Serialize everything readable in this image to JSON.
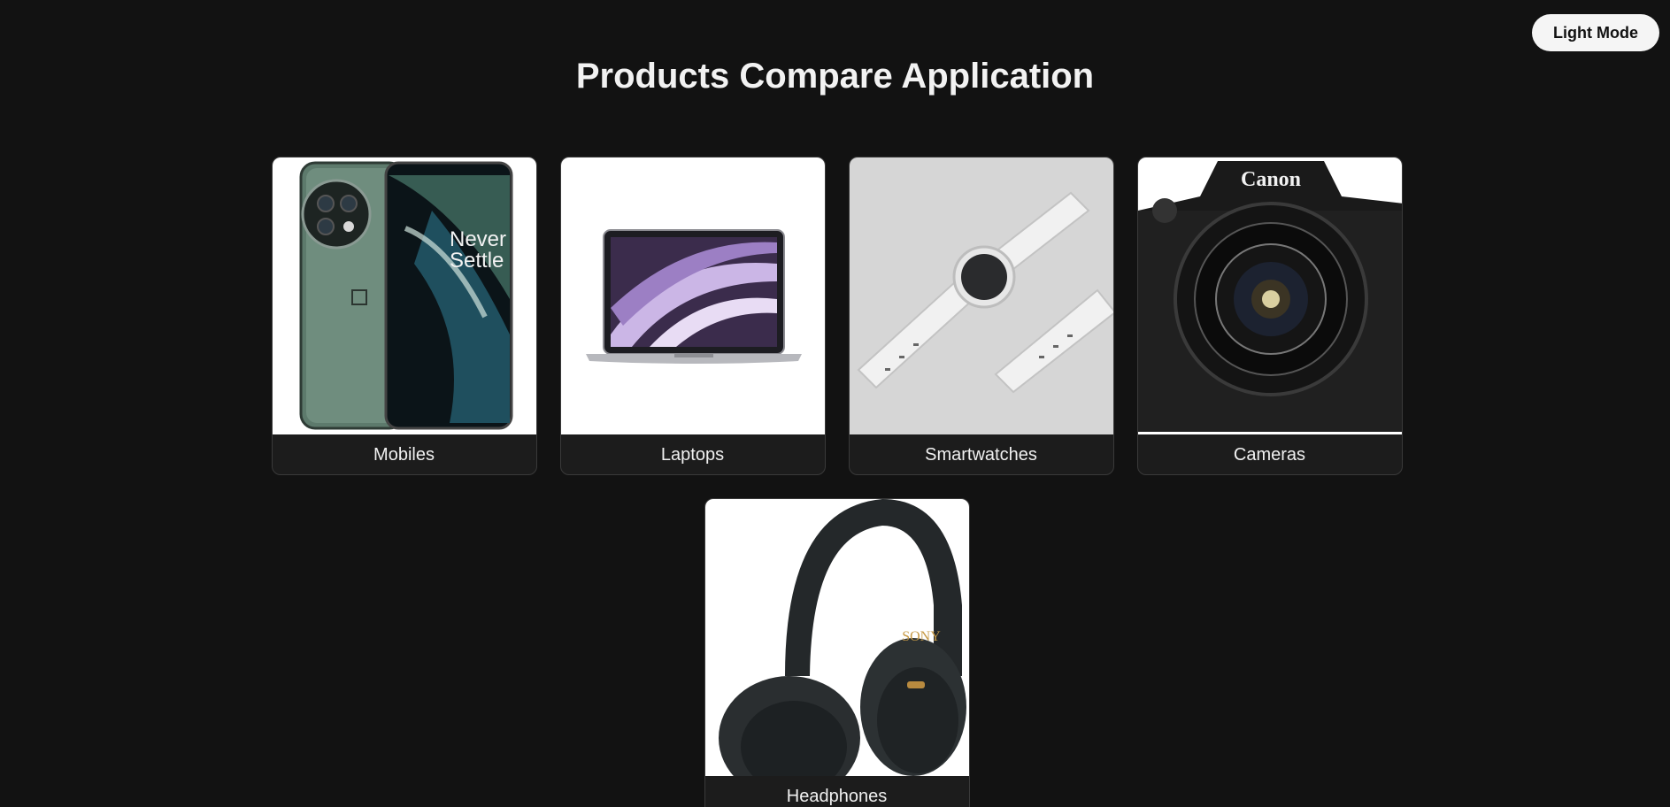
{
  "header": {
    "title": "Products Compare Application",
    "theme_toggle_label": "Light Mode"
  },
  "categories": [
    {
      "label": "Mobiles",
      "icon": "phone-image",
      "brand_text": "Never Settle"
    },
    {
      "label": "Laptops",
      "icon": "laptop-image"
    },
    {
      "label": "Smartwatches",
      "icon": "smartwatch-image"
    },
    {
      "label": "Cameras",
      "icon": "camera-image",
      "brand_text": "Canon"
    },
    {
      "label": "Headphones",
      "icon": "headphones-image",
      "brand_text": "SONY"
    }
  ],
  "colors": {
    "background": "#121212",
    "card_label_bg": "#1c1c1c",
    "toggle_bg": "#f5f5f5"
  }
}
